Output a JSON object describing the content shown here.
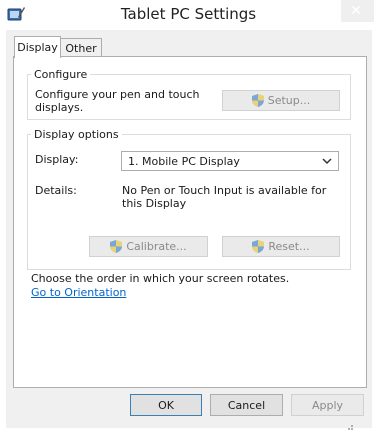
{
  "window": {
    "title": "Tablet PC Settings",
    "close_glyph": "✕"
  },
  "tabs": [
    {
      "label": "Display",
      "active": true
    },
    {
      "label": "Other",
      "active": false
    }
  ],
  "configure": {
    "title": "Configure",
    "text": "Configure your pen and touch displays.",
    "setup_label": "Setup..."
  },
  "display_options": {
    "title": "Display options",
    "display_label": "Display:",
    "display_value": "1. Mobile PC Display",
    "details_label": "Details:",
    "details_value": "No Pen or Touch Input is available for this Display",
    "calibrate_label": "Calibrate...",
    "reset_label": "Reset..."
  },
  "orientation": {
    "text": "Choose the order in which your screen rotates.",
    "link": "Go to Orientation"
  },
  "footer": {
    "ok_label": "OK",
    "cancel_label": "Cancel",
    "apply_label": "Apply"
  },
  "icons": {
    "app": "tablet-pen-icon",
    "shield": "uac-shield-icon",
    "chevron": "chevron-down-icon"
  },
  "colors": {
    "link": "#0066cc",
    "accent_border": "#3c7fb1"
  }
}
